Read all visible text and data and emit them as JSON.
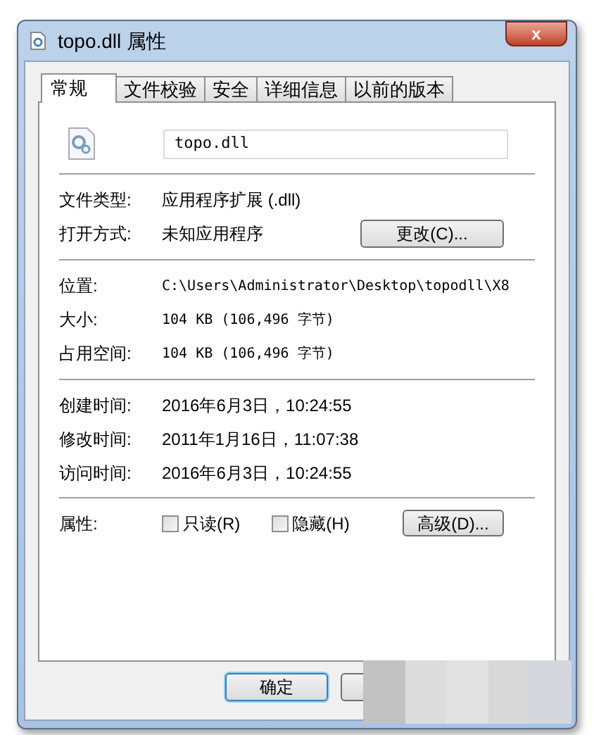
{
  "window": {
    "title": "topo.dll 属性",
    "close": "x"
  },
  "tabs": [
    {
      "label": "常规",
      "selected": true
    },
    {
      "label": "文件校验",
      "selected": false
    },
    {
      "label": "安全",
      "selected": false
    },
    {
      "label": "详细信息",
      "selected": false
    },
    {
      "label": "以前的版本",
      "selected": false
    }
  ],
  "file_name": "topo.dll",
  "sections": [
    [
      {
        "label": "文件类型:",
        "value": "应用程序扩展 (.dll)",
        "kind": "plain"
      },
      {
        "label": "打开方式:",
        "value": "未知应用程序",
        "button": "更改(C)..."
      }
    ],
    [
      {
        "label": "位置:",
        "value": "C:\\Users\\Administrator\\Desktop\\topodll\\X8",
        "kind": "mono"
      },
      {
        "label": "大小:",
        "value": "104 KB (106,496 字节)",
        "kind": "mono"
      },
      {
        "label": "占用空间:",
        "value": "104 KB (106,496 字节)",
        "kind": "mono"
      }
    ],
    [
      {
        "label": "创建时间:",
        "value": "2016年6月3日，10:24:55",
        "kind": "plain"
      },
      {
        "label": "修改时间:",
        "value": "2011年1月16日，11:07:38",
        "kind": "plain"
      },
      {
        "label": "访问时间:",
        "value": "2016年6月3日，10:24:55",
        "kind": "plain"
      }
    ]
  ],
  "attributes": {
    "label": "属性:",
    "checkboxes": [
      {
        "label": "只读(R)",
        "checked": false
      },
      {
        "label": "隐藏(H)",
        "checked": false
      }
    ],
    "button": "高级(D)..."
  },
  "buttons": [
    {
      "label": "确定",
      "default": true
    },
    {
      "default": false
    }
  ]
}
